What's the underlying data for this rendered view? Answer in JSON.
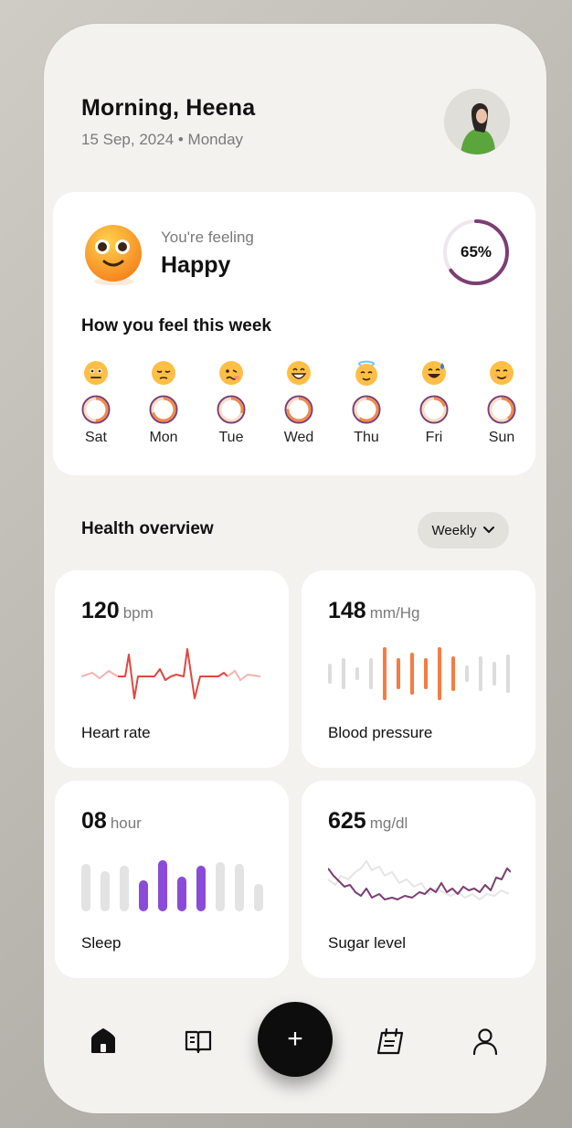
{
  "header": {
    "greeting": "Morning, Heena",
    "date": "15 Sep, 2024 • Monday"
  },
  "mood": {
    "feeling_label": "You're feeling",
    "feeling_value": "Happy",
    "percent_text": "65%",
    "percent": 65,
    "week_title": "How you feel this week",
    "days": [
      {
        "label": "Sat",
        "emoji": "neutral-face-icon",
        "fill": 0.5
      },
      {
        "label": "Mon",
        "emoji": "pensive-face-icon",
        "fill": 0.7
      },
      {
        "label": "Tue",
        "emoji": "woozy-face-icon",
        "fill": 0.3
      },
      {
        "label": "Wed",
        "emoji": "grinning-face-icon",
        "fill": 0.75
      },
      {
        "label": "Thu",
        "emoji": "halo-face-icon",
        "fill": 0.6
      },
      {
        "label": "Fri",
        "emoji": "sweat-smile-face-icon",
        "fill": 0.2
      },
      {
        "label": "Sun",
        "emoji": "smiling-face-icon",
        "fill": 0.4
      }
    ]
  },
  "health": {
    "title": "Health overview",
    "filter": "Weekly",
    "metrics": [
      {
        "value": "120",
        "unit": "bpm",
        "label": "Heart rate"
      },
      {
        "value": "148",
        "unit": "mm/Hg",
        "label": "Blood pressure"
      },
      {
        "value": "08",
        "unit": "hour",
        "label": "Sleep"
      },
      {
        "value": "625",
        "unit": "mg/dl",
        "label": "Sugar level"
      }
    ]
  },
  "nav": {
    "items": [
      "home-icon",
      "journal-icon",
      "add-icon",
      "calendar-icon",
      "profile-icon"
    ],
    "fab_label": "+"
  },
  "colors": {
    "accent_purple": "#7b3f73",
    "heart_red": "#e0473f",
    "pressure_orange": "#f57c42",
    "sleep_purple": "#8a4bd9",
    "card_bg": "#ffffff",
    "screen_bg": "#f3f2ef"
  }
}
